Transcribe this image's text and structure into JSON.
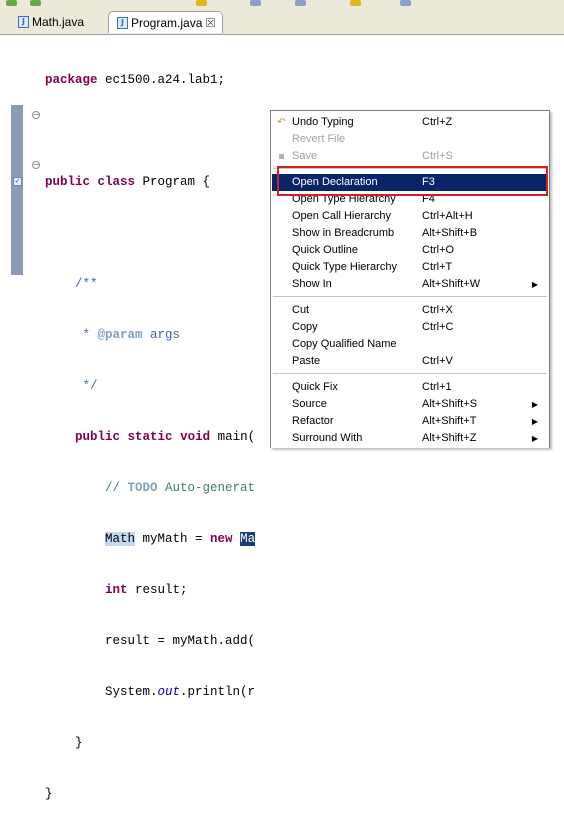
{
  "tabs": [
    {
      "label": "Math.java",
      "icon": "java-file-icon"
    },
    {
      "label": "Program.java",
      "icon": "java-file-icon",
      "close": "☒"
    }
  ],
  "code": {
    "l1": {
      "kw": "package",
      "rest": " ec1500.a24.lab1;"
    },
    "l2": {
      "kw1": "public",
      "kw2": "class",
      "rest": " Program {"
    },
    "l3": {
      "text": "    /**"
    },
    "l4": {
      "pre": "     * ",
      "tag": "@param",
      "rest": " args"
    },
    "l5": {
      "text": "     */"
    },
    "l6": {
      "pre": "    ",
      "kw1": "public",
      "kw2": "static",
      "kw3": "void",
      "rest": " main("
    },
    "l7": {
      "pre": "        ",
      "text": "// ",
      "todo": "TODO",
      "rest": " Auto-generat"
    },
    "l8": {
      "pre": "        ",
      "type": "Math",
      "rest": " myMath = ",
      "kw": "new",
      "sel": "Ma"
    },
    "l9": {
      "pre": "        ",
      "kw": "int",
      "rest": " result;"
    },
    "l10": {
      "text": "        result = myMath.add("
    },
    "l11": {
      "pre": "        System.",
      "field": "out",
      "rest": ".println(r"
    },
    "l12": {
      "text": "    }"
    },
    "l13": {
      "text": "}"
    }
  },
  "menu": {
    "items": [
      {
        "label": "Undo Typing",
        "shortcut": "Ctrl+Z",
        "icon": "undo-icon"
      },
      {
        "label": "Revert File",
        "shortcut": "",
        "disabled": true
      },
      {
        "label": "Save",
        "shortcut": "Ctrl+S",
        "disabled": true,
        "icon": "save-icon"
      },
      {
        "label": "Open Declaration",
        "shortcut": "F3",
        "highlighted": true
      },
      {
        "label": "Open Type Hierarchy",
        "shortcut": "F4"
      },
      {
        "label": "Open Call Hierarchy",
        "shortcut": "Ctrl+Alt+H"
      },
      {
        "label": "Show in Breadcrumb",
        "shortcut": "Alt+Shift+B"
      },
      {
        "label": "Quick Outline",
        "shortcut": "Ctrl+O"
      },
      {
        "label": "Quick Type Hierarchy",
        "shortcut": "Ctrl+T"
      },
      {
        "label": "Show In",
        "shortcut": "Alt+Shift+W",
        "submenu": true
      },
      {
        "label": "Cut",
        "shortcut": "Ctrl+X"
      },
      {
        "label": "Copy",
        "shortcut": "Ctrl+C"
      },
      {
        "label": "Copy Qualified Name",
        "shortcut": ""
      },
      {
        "label": "Paste",
        "shortcut": "Ctrl+V"
      },
      {
        "label": "Quick Fix",
        "shortcut": "Ctrl+1"
      },
      {
        "label": "Source",
        "shortcut": "Alt+Shift+S",
        "submenu": true
      },
      {
        "label": "Refactor",
        "shortcut": "Alt+Shift+T",
        "submenu": true
      },
      {
        "label": "Surround With",
        "shortcut": "Alt+Shift+Z",
        "submenu": true
      }
    ]
  },
  "colors": {
    "keyword": "#7f0055",
    "comment": "#3f7f5f",
    "javadoc": "#3f5fbf",
    "menu_highlight": "#0a246a",
    "callout_border": "#d42020"
  }
}
